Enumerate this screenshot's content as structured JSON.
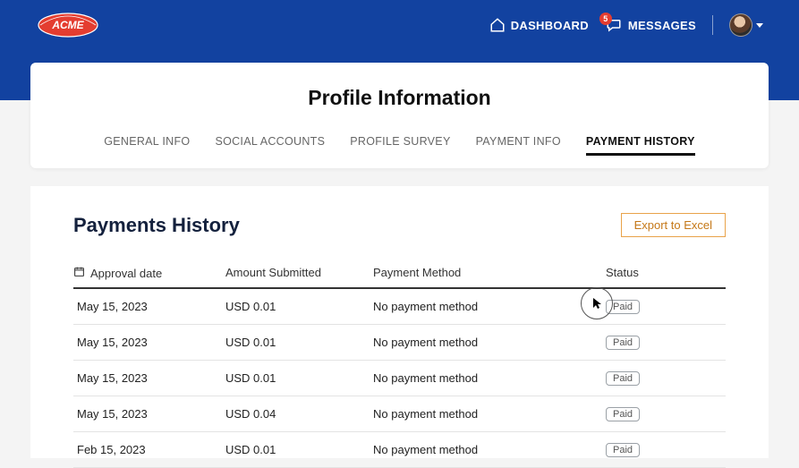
{
  "brand": {
    "name": "ACME"
  },
  "topnav": {
    "dashboard": "DASHBOARD",
    "messages": "MESSAGES",
    "message_count": "5"
  },
  "page": {
    "title": "Profile Information"
  },
  "tabs": {
    "general_info": "GENERAL INFO",
    "social_accounts": "SOCIAL ACCOUNTS",
    "profile_survey": "PROFILE SURVEY",
    "payment_info": "PAYMENT INFO",
    "payment_history": "PAYMENT HISTORY"
  },
  "section": {
    "title": "Payments History",
    "export_label": "Export to Excel"
  },
  "columns": {
    "approval_date": "Approval date",
    "amount_submitted": "Amount Submitted",
    "payment_method": "Payment Method",
    "status": "Status"
  },
  "rows": [
    {
      "date": "May 15, 2023",
      "amount": "USD 0.01",
      "method": "No payment method",
      "status": "Paid"
    },
    {
      "date": "May 15, 2023",
      "amount": "USD 0.01",
      "method": "No payment method",
      "status": "Paid"
    },
    {
      "date": "May 15, 2023",
      "amount": "USD 0.01",
      "method": "No payment method",
      "status": "Paid"
    },
    {
      "date": "May 15, 2023",
      "amount": "USD 0.04",
      "method": "No payment method",
      "status": "Paid"
    },
    {
      "date": "Feb 15, 2023",
      "amount": "USD 0.01",
      "method": "No payment method",
      "status": "Paid"
    }
  ]
}
